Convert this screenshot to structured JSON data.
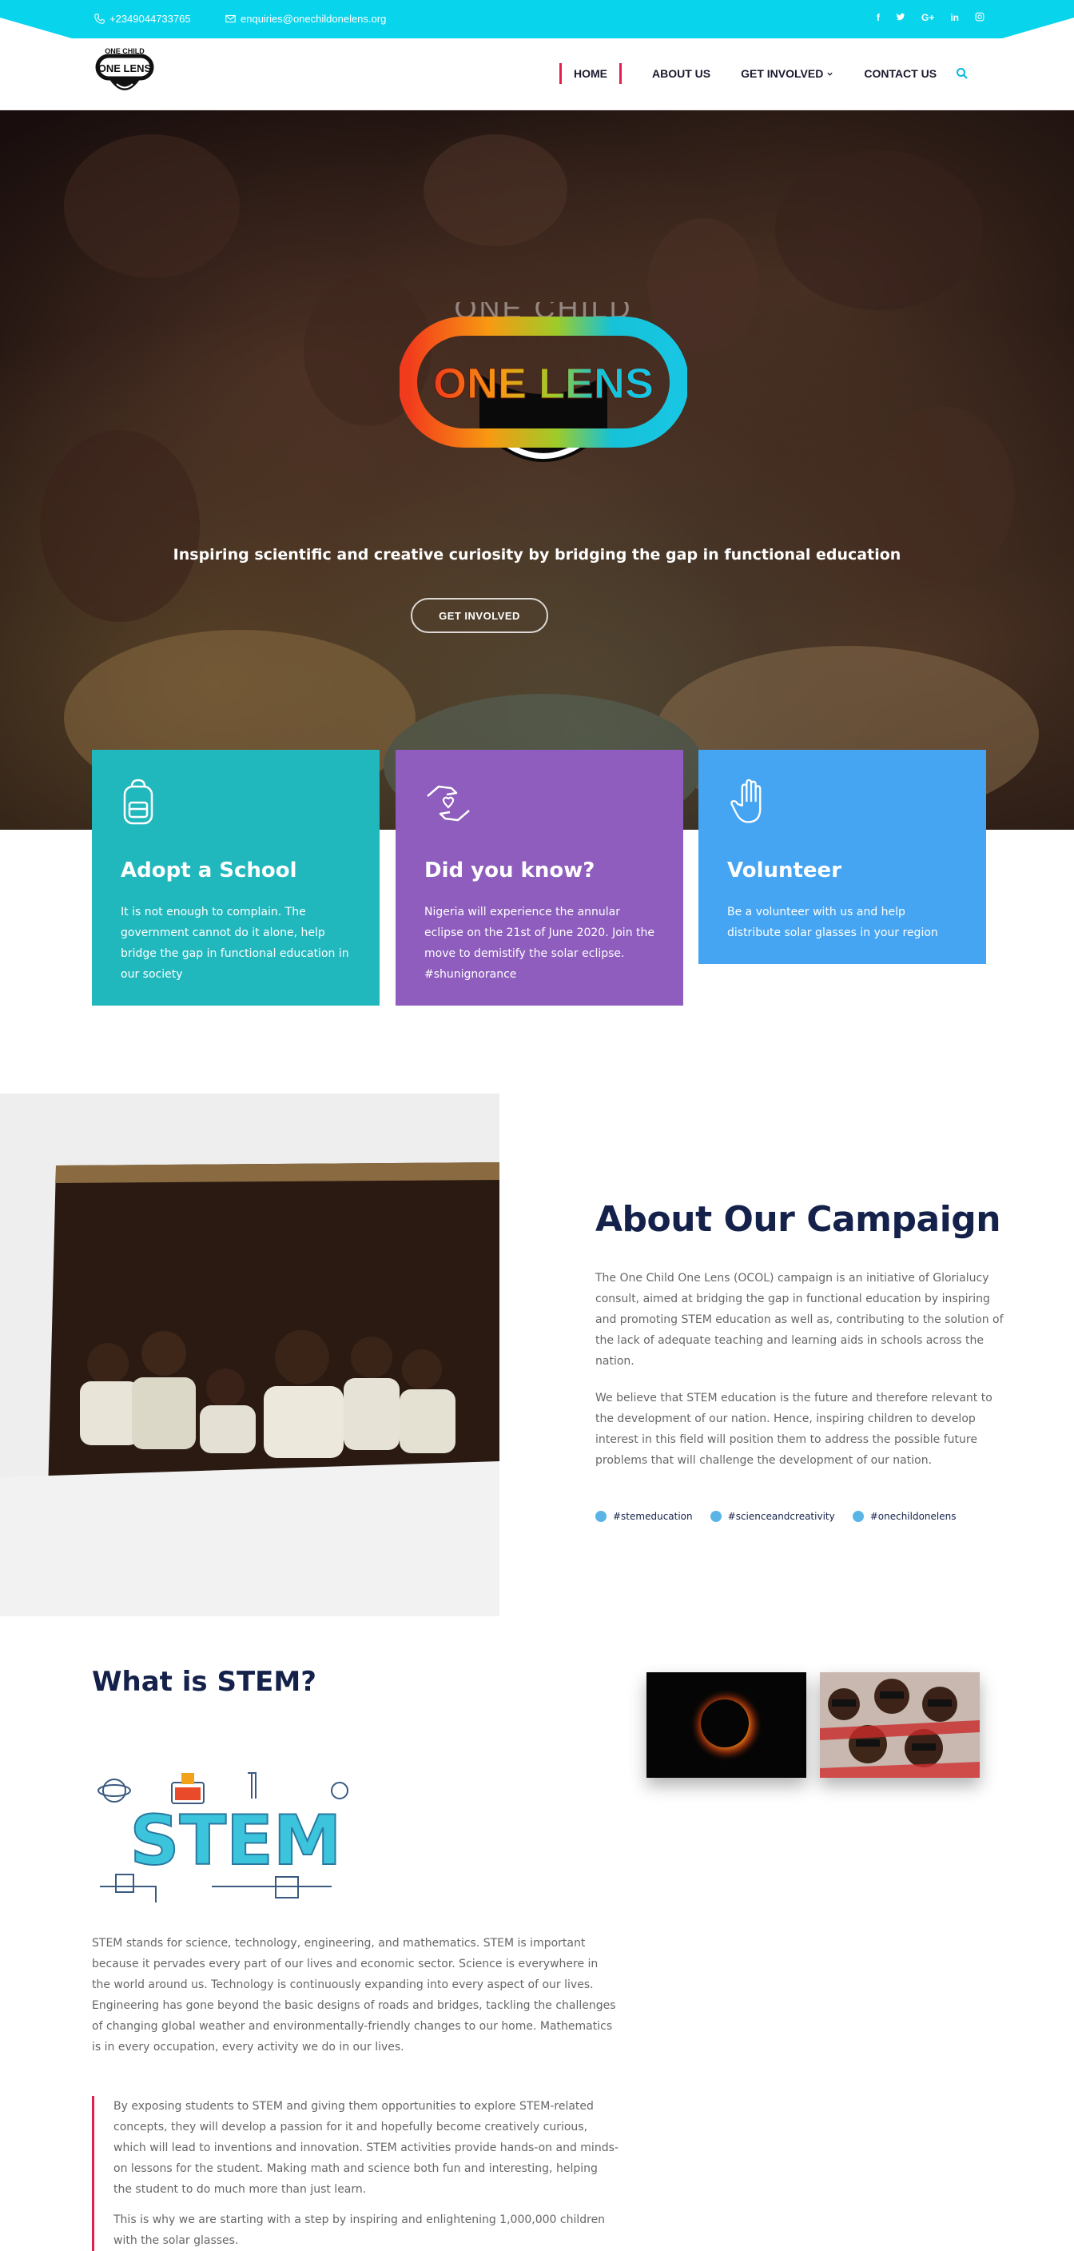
{
  "topbar": {
    "phone": "+2349044733765",
    "email": "enquiries@onechildonelens.org",
    "social": [
      "f",
      "t",
      "G+",
      "in",
      "ig"
    ]
  },
  "nav": {
    "items": [
      {
        "label": "HOME",
        "active": true
      },
      {
        "label": "ABOUT US"
      },
      {
        "label": "GET INVOLVED",
        "has_dropdown": true
      },
      {
        "label": "CONTACT US"
      }
    ]
  },
  "logo": {
    "line1": "ONE CHILD",
    "line2": "ONE LENS"
  },
  "hero": {
    "logo_top": "ONE CHILD",
    "logo_main": "ONE LENS",
    "tagline": "Inspiring scientific and creative curiosity by bridging the gap in functional education",
    "button": "GET INVOLVED"
  },
  "cards": [
    {
      "title": "Adopt a School",
      "text": "It is not enough to complain. The government cannot do it alone, help bridge the gap in functional education in our society",
      "icon": "backpack-icon",
      "color": "#21b8bd"
    },
    {
      "title": "Did you know?",
      "text": "Nigeria will experience the annular eclipse on the 21st of June 2020. Join the move to demistify the solar eclipse. #shunignorance",
      "icon": "care-hand-icon",
      "color": "#8e5dbd"
    },
    {
      "title": "Volunteer",
      "text": "Be a volunteer with us and help distribute solar glasses in your region",
      "icon": "raised-hand-icon",
      "color": "#45a5f2"
    }
  ],
  "about": {
    "title": "About Our Campaign",
    "p1": "The One Child One Lens (OCOL) campaign is an initiative of Glorialucy consult, aimed at bridging the gap in functional education by inspiring and promoting STEM education as well as, contributing to the solution of the lack of adequate teaching and learning aids in schools across the nation.",
    "p2": "We believe that STEM education is the future and therefore relevant to the development of our nation. Hence, inspiring children to develop interest in this field will position them to address the possible future problems that will challenge the development of our nation.",
    "tags": [
      "#stemeducation",
      "#scienceandcreativity",
      "#onechildonelens"
    ]
  },
  "stem": {
    "title": "What is STEM?",
    "logo_text": "STEM",
    "p1": "STEM stands for science, technology, engineering, and mathematics. STEM is important because it pervades every part of our lives and economic sector. Science is everywhere in the world around us. Technology is continuously expanding into every aspect of our lives. Engineering has gone beyond the basic designs of roads and bridges,  tackling the challenges of changing global weather and environmentally-friendly changes to our home. Mathematics is in every occupation, every activity we do in our lives.",
    "quote1": "By exposing students to STEM and giving them opportunities to explore STEM-related concepts, they will develop a passion for it and hopefully become creatively curious, which will lead to inventions and innovation.  STEM activities provide hands-on and minds-on lessons for the student. Making math and science both fun and interesting, helping the student to do much more than just learn.",
    "quote2": "This is why we are starting with a step by inspiring and enlightening 1,000,000 children with the solar glasses."
  },
  "colors": {
    "accent": "#08d4ec",
    "navy": "#14214a",
    "red": "#e61e4d"
  }
}
